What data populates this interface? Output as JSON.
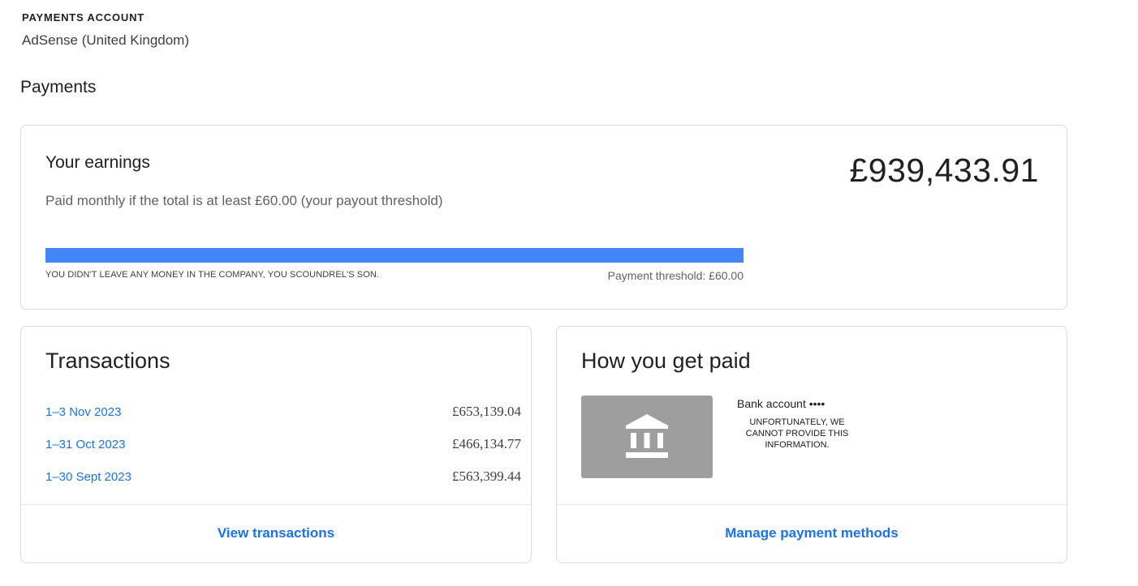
{
  "account": {
    "label": "PAYMENTS ACCOUNT",
    "name": "AdSense (United Kingdom)"
  },
  "page_title": "Payments",
  "earnings": {
    "title": "Your earnings",
    "subtitle": "Paid monthly if the total is at least £60.00 (your payout threshold)",
    "amount": "£939,433.91",
    "progress_fraction": 1.0,
    "progress_note": "YOU DIDN'T LEAVE ANY MONEY IN THE COMPANY, YOU SCOUNDREL'S SON.",
    "threshold_label": "Payment threshold: £60.00",
    "accent_color": "#4285f4"
  },
  "transactions": {
    "title": "Transactions",
    "rows": [
      {
        "period": "1–3 Nov 2023",
        "amount": "£653,139.04"
      },
      {
        "period": "1–31 Oct 2023",
        "amount": "£466,134.77"
      },
      {
        "period": "1–30 Sept 2023",
        "amount": "£563,399.44"
      }
    ],
    "footer_link": "View transactions"
  },
  "payment_method": {
    "title": "How you get paid",
    "icon": "bank-icon",
    "bank_name": "Bank account ••••",
    "note": "UNFORTUNATELY, WE CANNOT PROVIDE THIS INFORMATION.",
    "footer_link": "Manage payment methods"
  },
  "colors": {
    "link": "#1a73e8",
    "border": "#dadce0",
    "icon_tile": "#9e9e9e"
  }
}
